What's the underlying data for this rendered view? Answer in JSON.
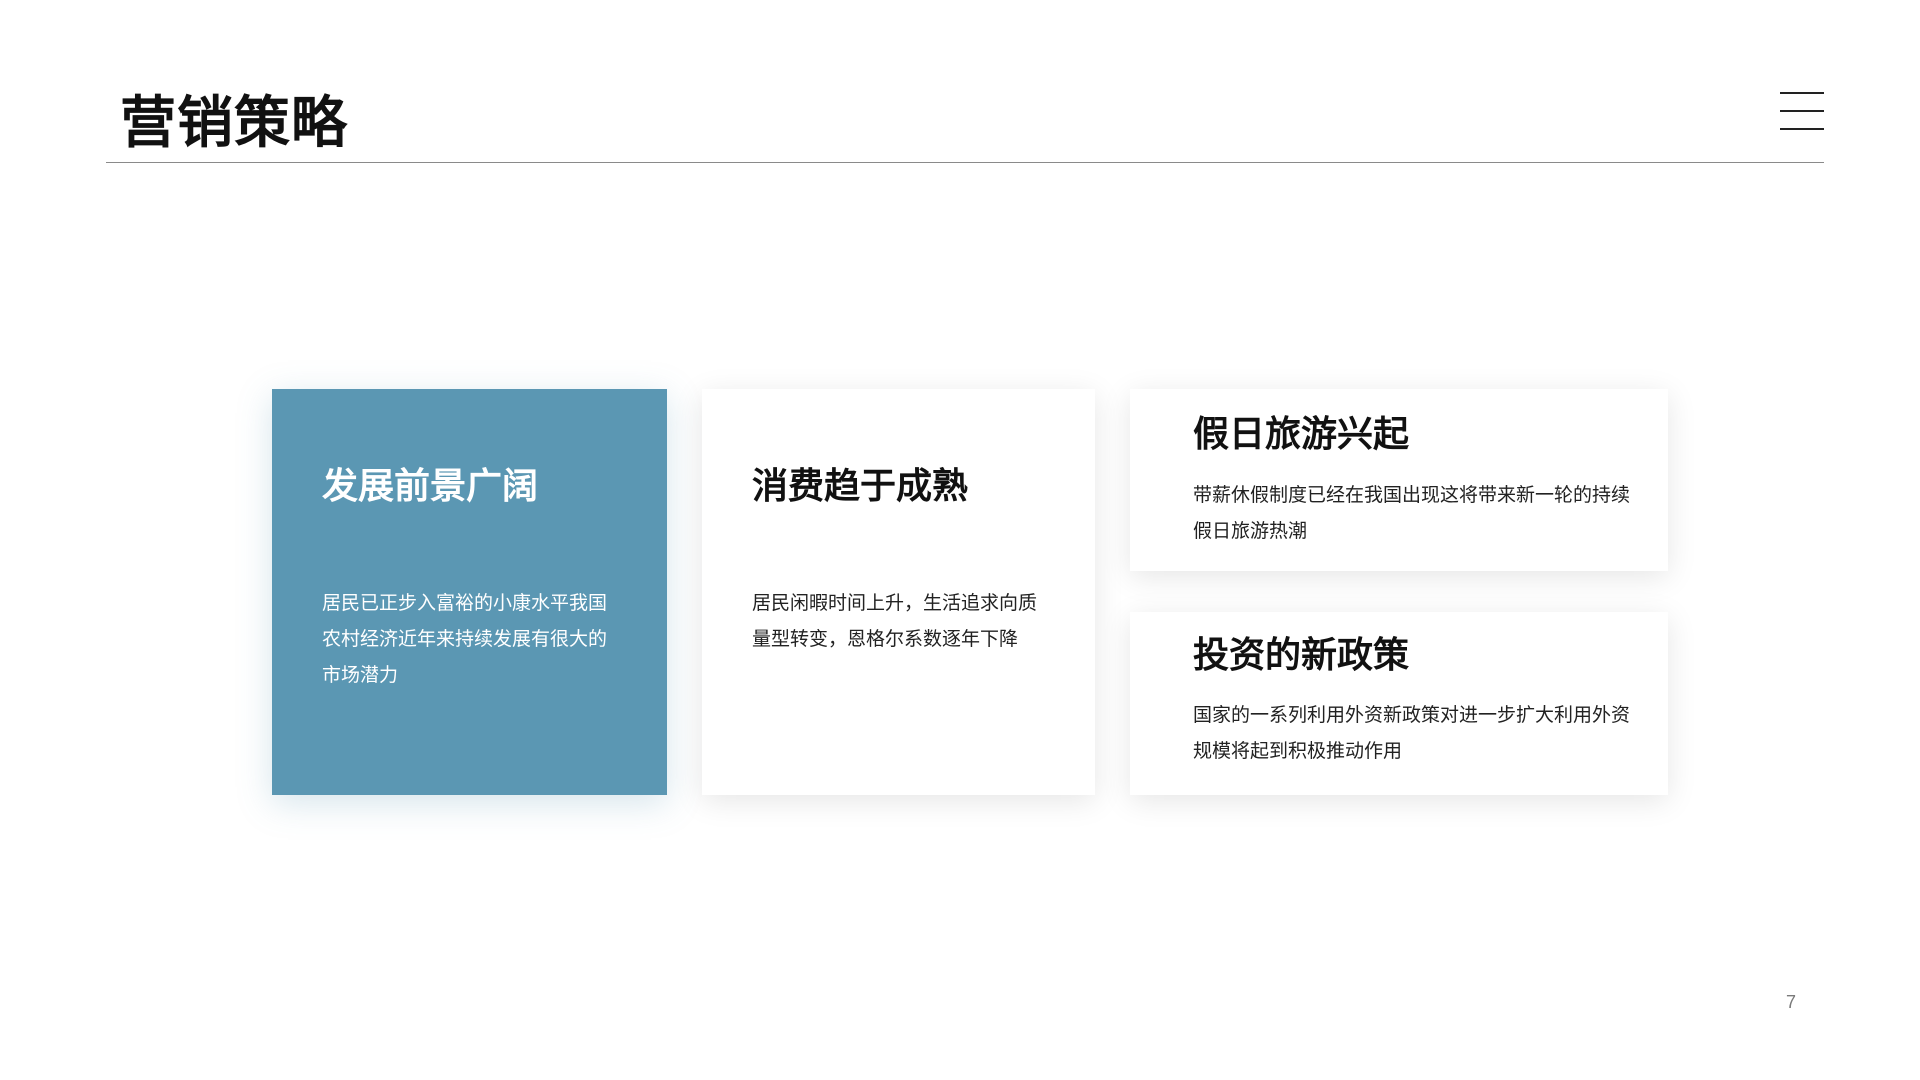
{
  "slide": {
    "title": "营销策略",
    "page_number": "7"
  },
  "cards": {
    "prospects": {
      "title": "发展前景广阔",
      "body": "居民已正步入富裕的小康水平我国农村经济近年来持续发展有很大的市场潜力"
    },
    "consumption": {
      "title": "消费趋于成熟",
      "body": "居民闲暇时间上升，生活追求向质量型转变，恩格尔系数逐年下降"
    },
    "holiday": {
      "title": "假日旅游兴起",
      "body": "带薪休假制度已经在我国出现这将带来新一轮的持续假日旅游热潮"
    },
    "investment": {
      "title": "投资的新政策",
      "body": "国家的一系列利用外资新政策对进一步扩大利用外资规模将起到积极推动作用"
    }
  },
  "colors": {
    "accent": "#5b97b3",
    "title_text": "#111111",
    "body_text": "#222222",
    "rule": "#8a8a8a",
    "page_number": "#7a7a7a"
  },
  "icons": {
    "menu": "hamburger-menu-icon"
  }
}
